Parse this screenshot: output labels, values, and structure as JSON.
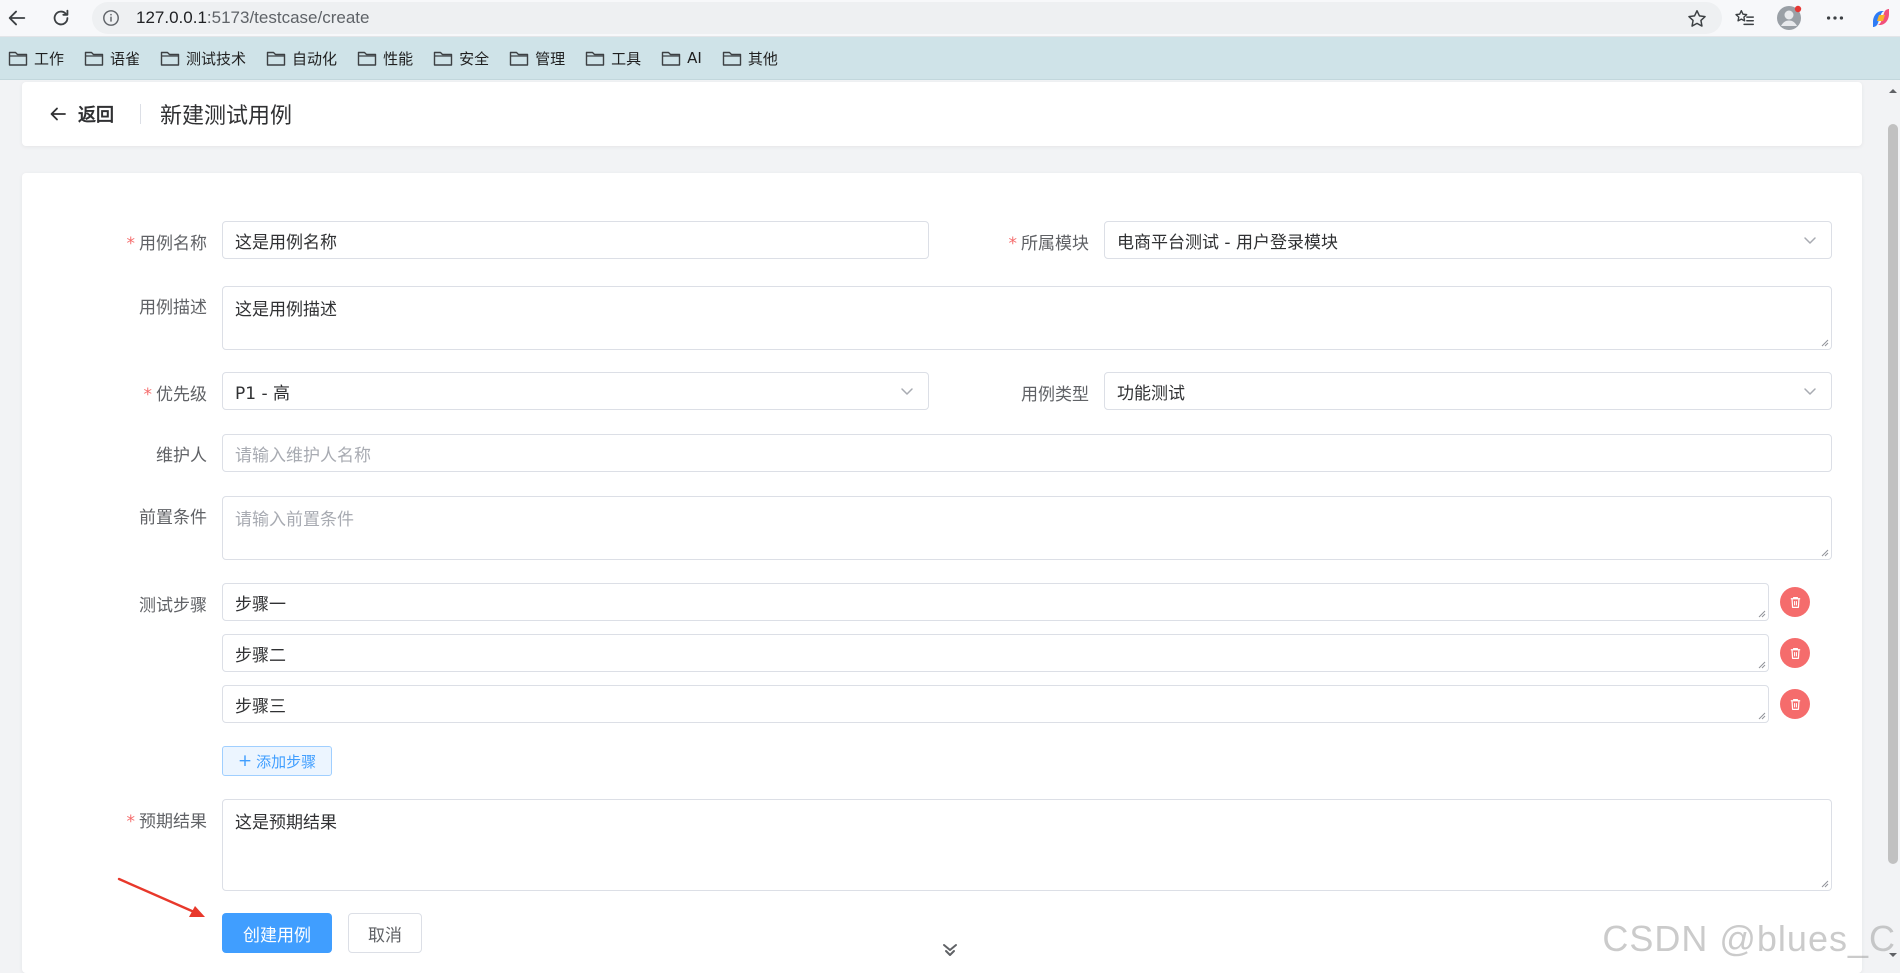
{
  "browser": {
    "url_host": "127.0.0.1",
    "url_path": ":5173/testcase/create",
    "bookmarks": [
      {
        "label": "工作"
      },
      {
        "label": "语雀"
      },
      {
        "label": "测试技术"
      },
      {
        "label": "自动化"
      },
      {
        "label": "性能"
      },
      {
        "label": "安全"
      },
      {
        "label": "管理"
      },
      {
        "label": "工具"
      },
      {
        "label": "AI"
      },
      {
        "label": "其他"
      }
    ]
  },
  "header": {
    "back_label": "返回",
    "title": "新建测试用例"
  },
  "form": {
    "case_name": {
      "label": "用例名称",
      "value": "这是用例名称"
    },
    "module": {
      "label": "所属模块",
      "value": "电商平台测试 - 用户登录模块"
    },
    "description": {
      "label": "用例描述",
      "value": "这是用例描述"
    },
    "priority": {
      "label": "优先级",
      "value": "P1 - 高"
    },
    "case_type": {
      "label": "用例类型",
      "value": "功能测试"
    },
    "maintainer": {
      "label": "维护人",
      "placeholder": "请输入维护人名称"
    },
    "precondition": {
      "label": "前置条件",
      "placeholder": "请输入前置条件"
    },
    "steps": {
      "label": "测试步骤",
      "items": [
        {
          "value": "步骤一"
        },
        {
          "value": "步骤二"
        },
        {
          "value": "步骤三"
        }
      ],
      "add_label": "添加步骤"
    },
    "expected": {
      "label": "预期结果",
      "value": "这是预期结果"
    },
    "submit_label": "创建用例",
    "cancel_label": "取消"
  },
  "watermark": "CSDN @blues_C",
  "colors": {
    "primary": "#409eff",
    "danger": "#f56c6c",
    "bookmark_bar": "#cfe3e8",
    "annotation_arrow": "#e8382b"
  }
}
